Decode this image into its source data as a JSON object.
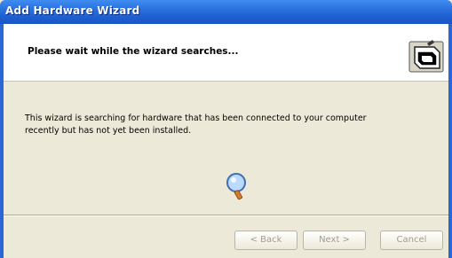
{
  "window": {
    "title": "Add Hardware Wizard"
  },
  "header": {
    "heading": "Please wait while the wizard searches..."
  },
  "body": {
    "line1": "This wizard is searching for hardware that has been connected to your computer",
    "line2": "recently but has not yet been installed."
  },
  "buttons": {
    "back": "< Back",
    "next": "Next >",
    "cancel": "Cancel"
  },
  "icons": {
    "header": "hardware-wizard-icon",
    "status": "magnifier-search-icon"
  },
  "colors": {
    "titlebar": "#2c73e0",
    "dialog_bg": "#ECE9D8",
    "header_bg": "#ffffff"
  }
}
